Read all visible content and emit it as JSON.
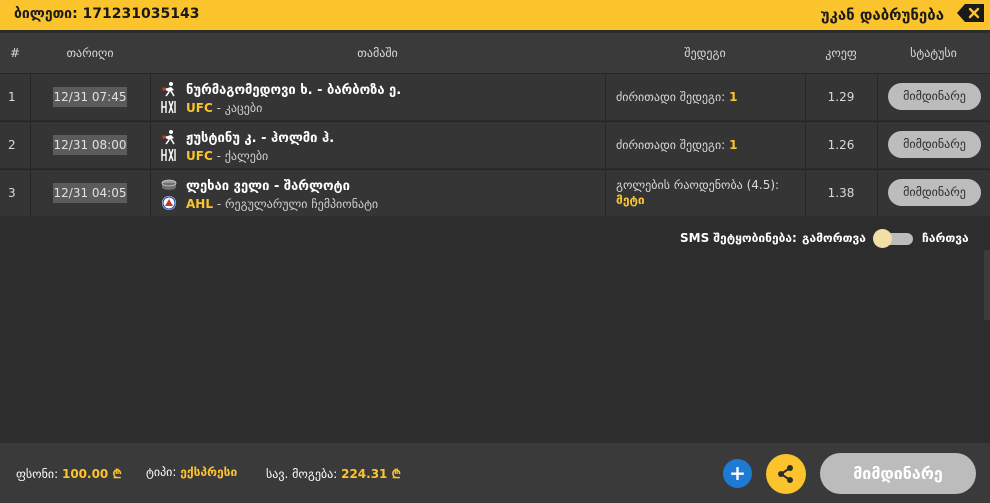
{
  "header": {
    "ticket_label": "ბილეთი:",
    "ticket_number": "171231035143",
    "back_label": "უკან დაბრუნება"
  },
  "table": {
    "columns": [
      "#",
      "თარიღი",
      "თამაში",
      "შედეგი",
      "კოეფ",
      "სტატუსი"
    ],
    "rows": [
      {
        "num": "1",
        "date": "12/31 07:45",
        "match": "ნურმაგომედოვი ხ. - ბარბოზა ე.",
        "league": "UFC",
        "league_suffix": "- კაცები",
        "result_label": "ძირითადი შედეგი:",
        "result_value": "1",
        "odds": "1.29",
        "status": "მიმდინარე",
        "sport_icon": "mma-fighter-icon",
        "league_icon": "ufc-logo-icon"
      },
      {
        "num": "2",
        "date": "12/31 08:00",
        "match": "ჟუსტინუ კ. - ჰოლმი ჰ.",
        "league": "UFC",
        "league_suffix": "- ქალები",
        "result_label": "ძირითადი შედეგი:",
        "result_value": "1",
        "odds": "1.26",
        "status": "მიმდინარე",
        "sport_icon": "mma-fighter-icon",
        "league_icon": "ufc-logo-icon"
      },
      {
        "num": "3",
        "date": "12/31 04:05",
        "match": "ლეხაი ველი - შარლოტი",
        "league": "AHL",
        "league_suffix": "- რეგულარული ჩემპიონატი",
        "result_label": "გოლების რაოდენობა (4.5):",
        "result_value": "მეტი",
        "odds": "1.38",
        "status": "მიმდინარე",
        "sport_icon": "hockey-puck-icon",
        "league_icon": "ahl-logo-icon"
      }
    ]
  },
  "sms": {
    "label": "SMS შეტყობინება:",
    "off_label": "გამორთვა",
    "on_label": "ჩართვა",
    "enabled": false
  },
  "footer": {
    "stake_label": "ფსონი:",
    "stake_value": "100.00 ₾",
    "type_label": "ტიპი:",
    "type_value": "ექსპრესი",
    "payout_label": "სავ. მოგება:",
    "payout_value": "224.31 ₾",
    "plus_label": "+",
    "status_label": "მიმდინარე"
  },
  "colors": {
    "accent": "#fcc42c",
    "background": "#2d2d2d",
    "status_button": "#bcbcbc",
    "plus_button": "#1f7ad4"
  }
}
